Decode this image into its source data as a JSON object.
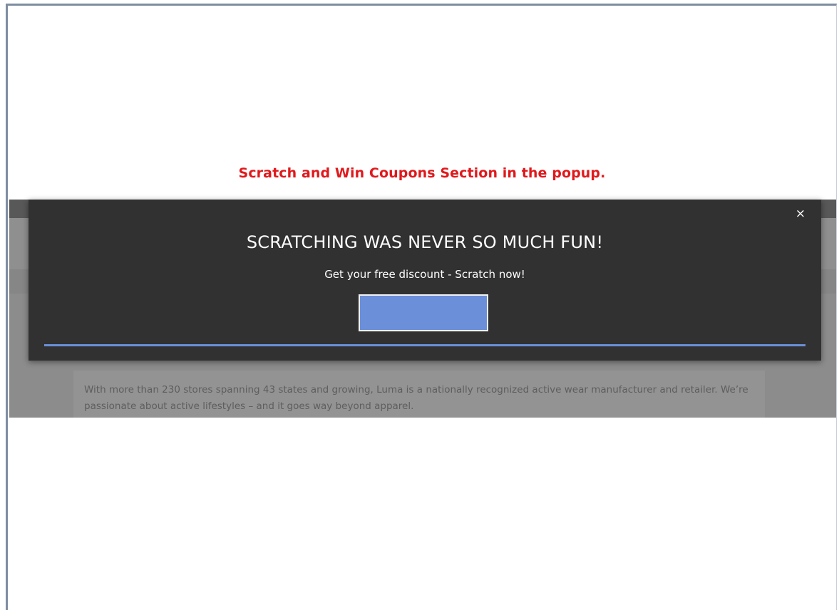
{
  "caption": "Scratch and Win Coupons Section in the popup.",
  "popup": {
    "close_icon": "×",
    "title": "SCRATCHING WAS NEVER SO MUCH FUN!",
    "subtitle": "Get your free discount - Scratch now!"
  },
  "background_page": {
    "intro_text": "With more than 230 stores spanning 43 states and growing, Luma is a nationally recognized active wear manufacturer and retailer. We’re passionate about active lifestyles – and it goes way beyond apparel."
  },
  "colors": {
    "caption": "#e0191c",
    "popup_background": "#313131",
    "scratch_card": "#6b8fd8",
    "overlay": "#8c8c8c"
  },
  "icons": {
    "close": "close-icon"
  }
}
